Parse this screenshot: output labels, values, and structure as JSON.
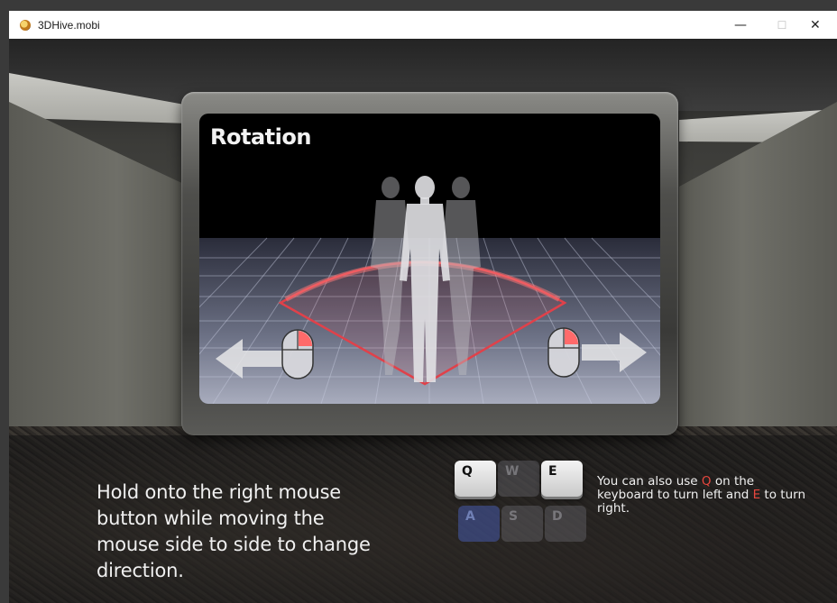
{
  "window": {
    "title": "3DHive.mobi",
    "minimize_glyph": "—",
    "maximize_glyph": "☐",
    "close_glyph": "✕"
  },
  "tutorial": {
    "screen_title": "Rotation",
    "instruction": "Hold onto the right mouse button while moving the mouse side to side to change direction.",
    "keys": [
      "Q",
      "W",
      "E",
      "A",
      "S",
      "D"
    ],
    "hint": {
      "part1": "You can also use ",
      "key_left": "Q",
      "part2": " on the keyboard to turn left and ",
      "key_right": "E",
      "part3": " to turn right."
    }
  },
  "colors": {
    "highlight": "#e8473e",
    "arc": "#e0414a"
  },
  "icons": [
    "app-icon",
    "mouse-left-icon",
    "mouse-right-icon",
    "arrow-left-icon",
    "arrow-right-icon"
  ]
}
